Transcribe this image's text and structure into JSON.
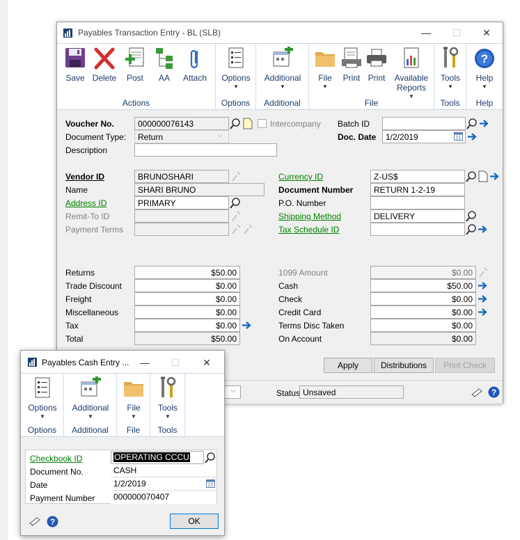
{
  "main_window": {
    "title": "Payables Transaction Entry  -  BL (SLB)",
    "controls": {
      "minimize": "—",
      "maximize": "☐",
      "close": "✕"
    },
    "ribbon": {
      "groups": [
        {
          "label": "Actions",
          "buttons": [
            "Save",
            "Delete",
            "Post",
            "AA",
            "Attach"
          ]
        },
        {
          "label": "Options",
          "buttons": [
            "Options"
          ]
        },
        {
          "label": "Additional",
          "buttons": [
            "Additional"
          ]
        },
        {
          "label": "File",
          "buttons": [
            "File",
            "Print",
            "Print",
            "Available Reports"
          ]
        },
        {
          "label": "Tools",
          "buttons": [
            "Tools"
          ]
        },
        {
          "label": "Help",
          "buttons": [
            "Help"
          ]
        }
      ]
    },
    "header": {
      "voucher_no_label": "Voucher No.",
      "voucher_no": "000000076143",
      "intercompany_label": "Intercompany",
      "document_type_label": "Document Type:",
      "document_type": "Return",
      "description_label": "Description",
      "description": "",
      "batch_id_label": "Batch ID",
      "batch_id": "",
      "doc_date_label": "Doc. Date",
      "doc_date": "1/2/2019"
    },
    "vendor": {
      "vendor_id_label": "Vendor ID",
      "vendor_id": "BRUNOSHARI",
      "name_label": "Name",
      "name": "SHARI BRUNO",
      "address_id_label": "Address ID",
      "address_id": "PRIMARY",
      "remit_to_label": "Remit-To ID",
      "remit_to": "",
      "payment_terms_label": "Payment Terms",
      "payment_terms": ""
    },
    "right_block": {
      "currency_id_label": "Currency ID",
      "currency_id": "Z-US$",
      "document_number_label": "Document Number",
      "document_number": "RETURN 1-2-19",
      "po_number_label": "P.O. Number",
      "po_number": "",
      "shipping_method_label": "Shipping Method",
      "shipping_method": "DELIVERY",
      "tax_schedule_label": "Tax Schedule ID",
      "tax_schedule": ""
    },
    "amounts_left": [
      {
        "label": "Returns",
        "value": "$50.00"
      },
      {
        "label": "Trade Discount",
        "value": "$0.00"
      },
      {
        "label": "Freight",
        "value": "$0.00"
      },
      {
        "label": "Miscellaneous",
        "value": "$0.00"
      },
      {
        "label": "Tax",
        "value": "$0.00"
      },
      {
        "label": "Total",
        "value": "$50.00"
      }
    ],
    "amounts_right": [
      {
        "label": "1099 Amount",
        "value": "$0.00"
      },
      {
        "label": "Cash",
        "value": "$50.00"
      },
      {
        "label": "Check",
        "value": "$0.00"
      },
      {
        "label": "Credit Card",
        "value": "$0.00"
      },
      {
        "label": "Terms Disc Taken",
        "value": "$0.00"
      },
      {
        "label": "On Account",
        "value": "$0.00"
      }
    ],
    "buttons": {
      "apply": "Apply",
      "distributions": "Distributions",
      "print_check": "Print Check"
    },
    "status_label": "Status",
    "status_value": "Unsaved"
  },
  "cash_window": {
    "title": "Payables Cash Entry ...",
    "controls": {
      "minimize": "—",
      "maximize": "☐",
      "close": "✕"
    },
    "ribbon": {
      "groups": [
        {
          "label": "Options",
          "buttons": [
            "Options"
          ]
        },
        {
          "label": "Additional",
          "buttons": [
            "Additional"
          ]
        },
        {
          "label": "File",
          "buttons": [
            "File"
          ]
        },
        {
          "label": "Tools",
          "buttons": [
            "Tools"
          ]
        }
      ]
    },
    "checkbook_id_label": "Checkbook ID",
    "checkbook_id": "OPERATING CCCU",
    "document_no_label": "Document No.",
    "document_no": "CASH",
    "date_label": "Date",
    "date": "1/2/2019",
    "payment_number_label": "Payment Number",
    "payment_number": "000000070407",
    "ok_label": "OK"
  },
  "colors": {
    "link": "#008000",
    "ribbon_text": "#1d3b6a",
    "form_bg": "#f0f0f0",
    "accent_blue": "#1565c0"
  }
}
